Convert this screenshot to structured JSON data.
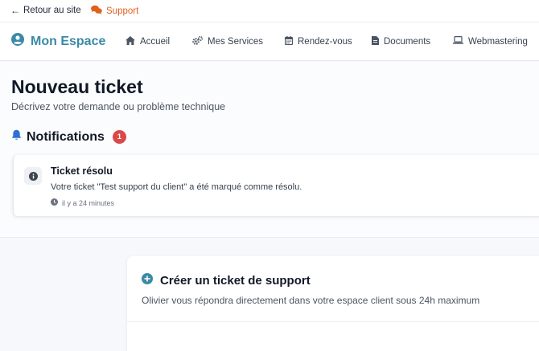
{
  "topbar": {
    "back_label": "Retour au site",
    "support_label": "Support"
  },
  "navbar": {
    "brand": "Mon Espace",
    "items": [
      {
        "label": "Accueil",
        "icon": "home-icon"
      },
      {
        "label": "Mes Services",
        "icon": "cogs-icon"
      },
      {
        "label": "Rendez-vous",
        "icon": "calendar-icon"
      },
      {
        "label": "Documents",
        "icon": "document-icon"
      },
      {
        "label": "Webmastering",
        "icon": "laptop-icon"
      }
    ]
  },
  "page": {
    "title": "Nouveau ticket",
    "subtitle": "Décrivez votre demande ou problème technique"
  },
  "notifications": {
    "title": "Notifications",
    "count": "1",
    "items": [
      {
        "title": "Ticket résolu",
        "message": "Votre ticket \"Test support du client\" a été marqué comme résolu.",
        "time": "il y a 24 minutes"
      }
    ]
  },
  "create_ticket": {
    "title": "Créer un ticket de support",
    "subtitle": "Olivier vous répondra directement dans votre espace client sous 24h maximum"
  },
  "colors": {
    "brand": "#3b8aa6",
    "support": "#e0611f",
    "badge": "#dc4848",
    "bell": "#2f6fd6"
  }
}
